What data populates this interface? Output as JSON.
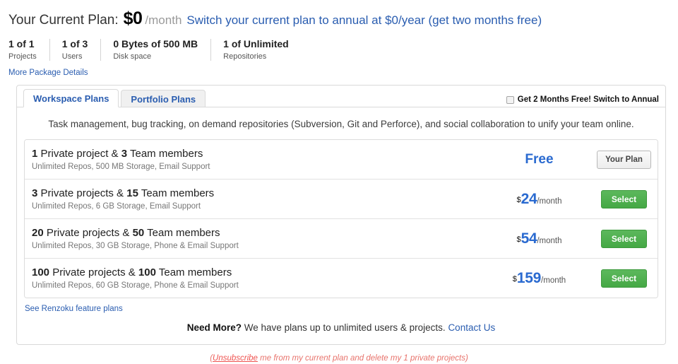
{
  "header": {
    "title": "Your Current Plan:",
    "price": "$0",
    "per": "/month",
    "switch_link": "Switch your current plan to annual at $0/year (get two months free)"
  },
  "stats": [
    {
      "value": "1 of 1",
      "label": "Projects"
    },
    {
      "value": "1 of 3",
      "label": "Users"
    },
    {
      "value": "0 Bytes of 500 MB",
      "label": "Disk space"
    },
    {
      "value": "1 of Unlimited",
      "label": "Repositories"
    }
  ],
  "more_package_details": "More Package Details",
  "tabs": [
    {
      "label": "Workspace Plans",
      "active": true
    },
    {
      "label": "Portfolio Plans",
      "active": false
    }
  ],
  "annual_checkbox": {
    "label": "Get 2 Months Free! Switch to Annual",
    "checked": false
  },
  "description": "Task management, bug tracking, on demand repositories (Subversion, Git and Perforce), and social collaboration to unify your team online.",
  "plans": [
    {
      "projects_count": "1",
      "projects_text": " Private project & ",
      "members_count": "3",
      "members_text": " Team members",
      "features": "Unlimited Repos, 500 MB Storage, Email Support",
      "price_currency": "",
      "price_amount": "Free",
      "price_period": "",
      "is_free": true,
      "action_label": "Your Plan",
      "action_type": "current"
    },
    {
      "projects_count": "3",
      "projects_text": " Private projects & ",
      "members_count": "15",
      "members_text": " Team members",
      "features": "Unlimited Repos, 6 GB Storage, Email Support",
      "price_currency": "$",
      "price_amount": "24",
      "price_period": "/month",
      "is_free": false,
      "action_label": "Select",
      "action_type": "select"
    },
    {
      "projects_count": "20",
      "projects_text": " Private projects & ",
      "members_count": "50",
      "members_text": " Team members",
      "features": "Unlimited Repos, 30 GB Storage, Phone & Email Support",
      "price_currency": "$",
      "price_amount": "54",
      "price_period": "/month",
      "is_free": false,
      "action_label": "Select",
      "action_type": "select"
    },
    {
      "projects_count": "100",
      "projects_text": " Private projects & ",
      "members_count": "100",
      "members_text": " Team members",
      "features": "Unlimited Repos, 60 GB Storage, Phone & Email Support",
      "price_currency": "$",
      "price_amount": "159",
      "price_period": "/month",
      "is_free": false,
      "action_label": "Select",
      "action_type": "select"
    }
  ],
  "feature_plans_link": "See Renzoku feature plans",
  "need_more": {
    "bold": "Need More?",
    "text": " We have plans up to unlimited users & projects. ",
    "link": "Contact Us"
  },
  "unsubscribe": {
    "open_paren": "(",
    "link": "Unsubscribe",
    "text": " me from my current plan and delete my 1 private projects)"
  },
  "colors": {
    "link_blue": "#2a5db0",
    "price_blue": "#2a6ad0",
    "select_green": "#4caf50",
    "unsubscribe_red": "#ef5350",
    "border_gray": "#d9d9d9"
  }
}
